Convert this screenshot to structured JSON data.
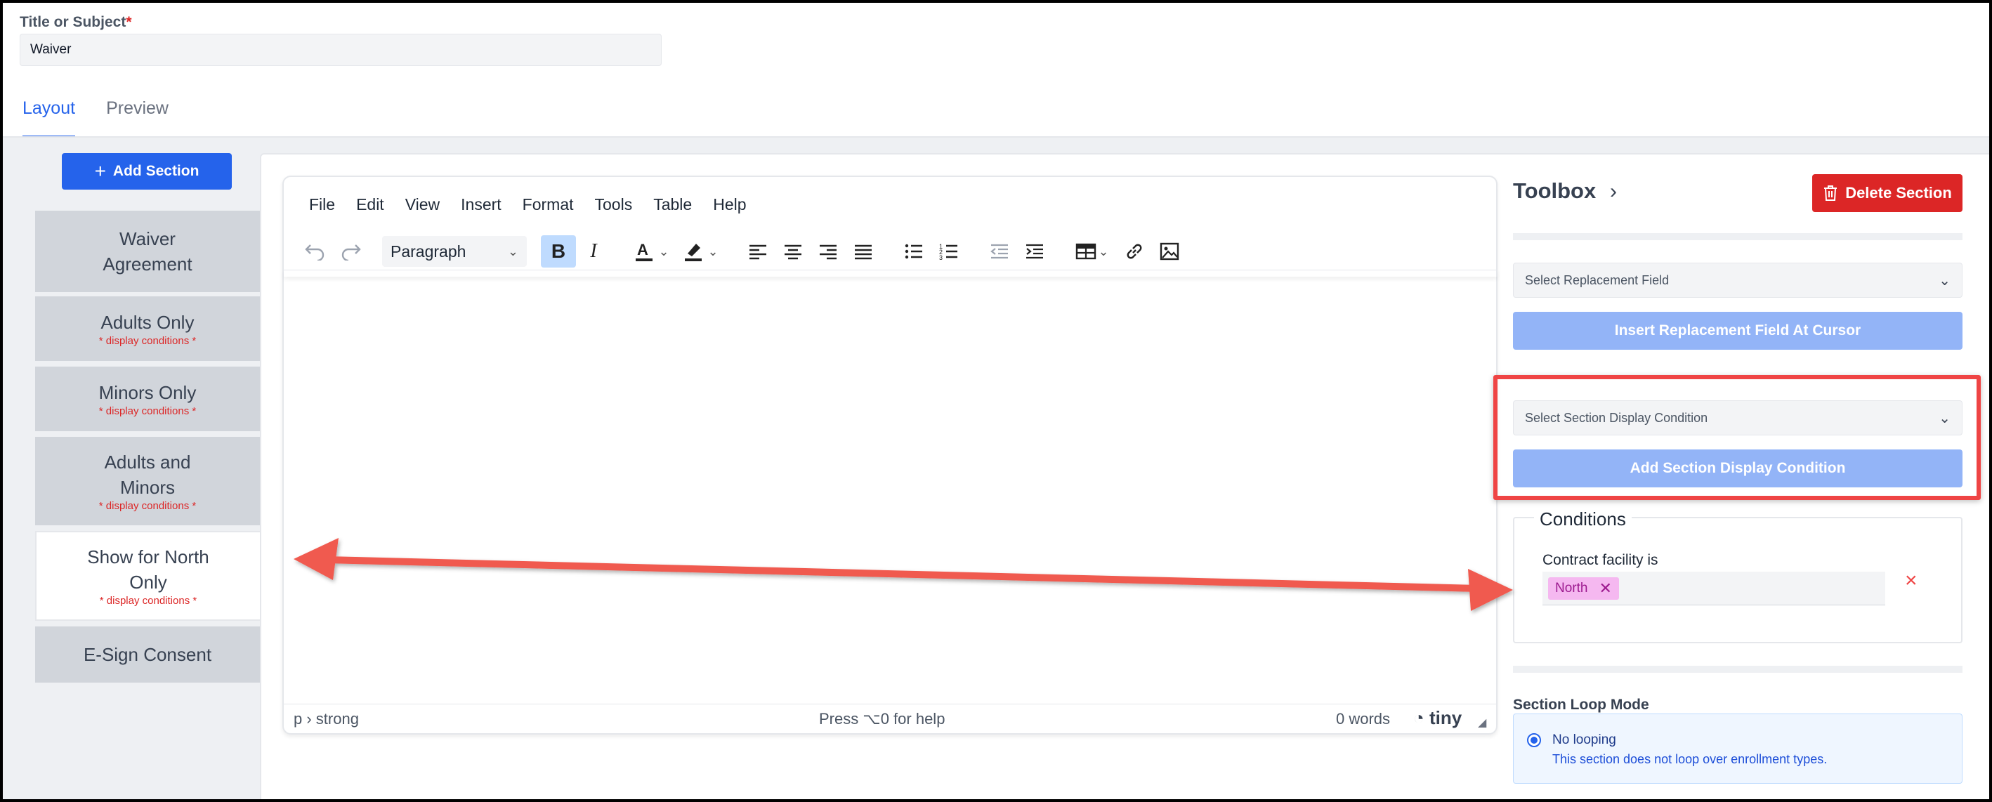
{
  "title_field": {
    "label": "Title or Subject",
    "required_mark": "*",
    "value": "Waiver"
  },
  "tabs": [
    {
      "label": "Layout",
      "active": true
    },
    {
      "label": "Preview",
      "active": false
    }
  ],
  "sidebar": {
    "add_button": "Add Section",
    "sections": [
      {
        "label": "Waiver Agreement",
        "note": ""
      },
      {
        "label": "Adults Only",
        "note": "* display conditions *"
      },
      {
        "label": "Minors Only",
        "note": "* display conditions *"
      },
      {
        "label": "Adults and Minors",
        "note": "* display conditions *"
      },
      {
        "label": "Show for North Only",
        "note": "* display conditions *",
        "active": true
      },
      {
        "label": "E-Sign Consent",
        "note": ""
      }
    ]
  },
  "editor": {
    "menu": [
      "File",
      "Edit",
      "View",
      "Insert",
      "Format",
      "Tools",
      "Table",
      "Help"
    ],
    "block_format": "Paragraph",
    "status_path": "p › strong",
    "status_help": "Press ⌥0 for help",
    "word_count": "0 words",
    "brand": "tiny",
    "toolbar_icons": [
      "undo-icon",
      "redo-icon",
      "bold-icon",
      "italic-icon",
      "text-color-icon",
      "highlight-icon",
      "align-left-icon",
      "align-center-icon",
      "align-right-icon",
      "justify-icon",
      "bullet-list-icon",
      "numbered-list-icon",
      "outdent-icon",
      "indent-icon",
      "table-icon",
      "link-icon",
      "image-icon"
    ]
  },
  "toolbox": {
    "title": "Toolbox",
    "delete_button": "Delete Section",
    "replacement_placeholder": "Select Replacement Field",
    "insert_button": "Insert Replacement Field At Cursor",
    "condition_placeholder": "Select Section Display Condition",
    "add_condition_button": "Add Section Display Condition",
    "conditions_legend": "Conditions",
    "condition": {
      "field": "Contract facility is",
      "value": "North"
    },
    "loop": {
      "title": "Section Loop Mode",
      "option": "No looping",
      "description": "This section does not loop over enrollment types."
    }
  },
  "colors": {
    "primary": "#2563eb",
    "danger": "#dc2626",
    "annotation": "#ef4444",
    "chip": "#f5b8f0"
  }
}
